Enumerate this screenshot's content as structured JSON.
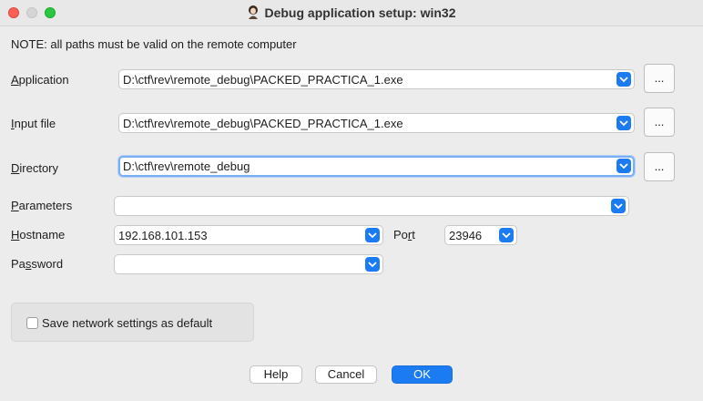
{
  "window": {
    "title": "Debug application setup: win32"
  },
  "note": "NOTE: all paths must be valid on the remote computer",
  "fields": {
    "application": {
      "label_mnemonic": "A",
      "label_rest": "pplication",
      "value": "D:\\ctf\\rev\\remote_debug\\PACKED_PRACTICA_1.exe"
    },
    "input_file": {
      "label_mnemonic": "I",
      "label_rest": "nput file",
      "value": "D:\\ctf\\rev\\remote_debug\\PACKED_PRACTICA_1.exe"
    },
    "directory": {
      "label_mnemonic": "D",
      "label_rest": "irectory",
      "value": "D:\\ctf\\rev\\remote_debug"
    },
    "parameters": {
      "label_mnemonic": "P",
      "label_rest": "arameters",
      "value": ""
    },
    "hostname": {
      "label_mnemonic": "H",
      "label_rest": "ostname",
      "value": "192.168.101.153"
    },
    "port": {
      "label_before": "Po",
      "label_mnemonic": "r",
      "label_after": "t",
      "value": "23946"
    },
    "password": {
      "label_before": "Pa",
      "label_mnemonic": "s",
      "label_after": "sword",
      "value": ""
    }
  },
  "browse_label": "...",
  "save_default": {
    "label": "Save network settings as default",
    "checked": false
  },
  "buttons": {
    "help": "Help",
    "cancel": "Cancel",
    "ok": "OK"
  },
  "colors": {
    "accent": "#1a7bf3",
    "close": "#fe5f57",
    "zoom": "#28c840"
  }
}
